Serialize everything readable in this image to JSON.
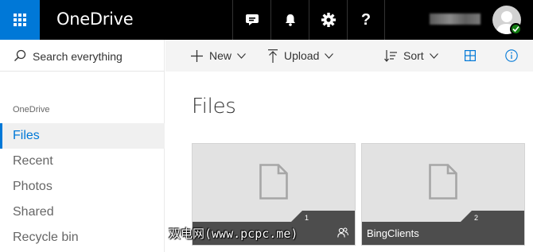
{
  "header": {
    "app_name": "OneDrive",
    "icons": [
      "waffle-icon",
      "feedback-icon",
      "bell-icon",
      "gear-icon",
      "help-icon"
    ],
    "help_glyph": "?",
    "accent": "#0078d7",
    "status_color": "#107c10"
  },
  "sidebar": {
    "search_placeholder": "Search everything",
    "section_label": "OneDrive",
    "items": [
      {
        "label": "Files",
        "active": true
      },
      {
        "label": "Recent"
      },
      {
        "label": "Photos"
      },
      {
        "label": "Shared"
      },
      {
        "label": "Recycle bin"
      }
    ]
  },
  "toolbar": {
    "new_label": "New",
    "upload_label": "Upload",
    "sort_label": "Sort"
  },
  "main": {
    "title": "Files",
    "tiles": [
      {
        "name": "",
        "count": "1",
        "shared": true
      },
      {
        "name": "BingClients",
        "count": "2",
        "shared": false
      }
    ]
  },
  "watermark": "双电网(www.pcpc.me)"
}
